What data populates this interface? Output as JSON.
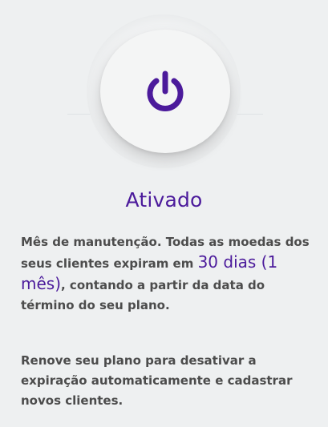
{
  "status": {
    "title": "Ativado"
  },
  "description": {
    "text_before": "Mês de manutenção. Todas as moedas dos seus clientes expiram em ",
    "highlight": "30 dias (1 mês)",
    "text_after": ", contando a partir da data do término do seu plano."
  },
  "renew_note": "Renove seu plano para desativar a expiração automaticamente e cadastrar novos clientes.",
  "icons": {
    "power": "power-icon"
  },
  "colors": {
    "accent": "#4b1a9b",
    "body_text": "#4c4c4c",
    "background": "#eef0f1"
  }
}
